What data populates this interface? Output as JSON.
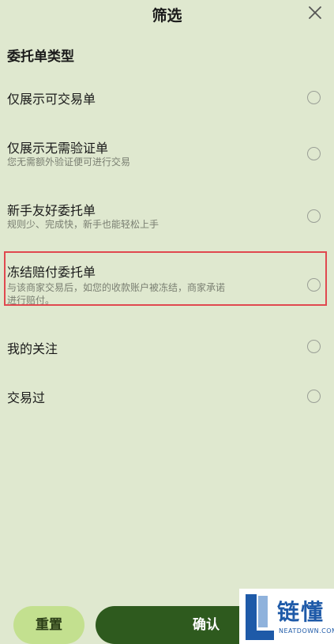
{
  "header": {
    "title": "筛选",
    "close_icon": "close-icon"
  },
  "section": {
    "title": "委托单类型"
  },
  "options": [
    {
      "label": "仅展示可交易单",
      "sub": "",
      "selected": false
    },
    {
      "label": "仅展示无需验证单",
      "sub": "您无需额外验证便可进行交易",
      "selected": false
    },
    {
      "label": "新手友好委托单",
      "sub": "规则少、完成快，新手也能轻松上手",
      "selected": false
    },
    {
      "label": "冻结赔付委托单",
      "sub_line1": "与该商家交易后，如您的收款账户被冻结，商家承诺",
      "sub_line2": "进行赔付。",
      "selected": false,
      "highlighted": true
    },
    {
      "label": "我的关注",
      "sub": "",
      "selected": false
    },
    {
      "label": "交易过",
      "sub": "",
      "selected": false
    }
  ],
  "footer": {
    "reset_label": "重置",
    "confirm_label": "确认"
  },
  "watermark": {
    "main": "链懂",
    "sub": "NEATDOWN.COM"
  },
  "colors": {
    "background": "#dfe8cf",
    "reset_button": "#c3e08f",
    "confirm_button": "#2e5a1e",
    "highlight_border": "#e0484f",
    "watermark": "#1e5aa8"
  }
}
